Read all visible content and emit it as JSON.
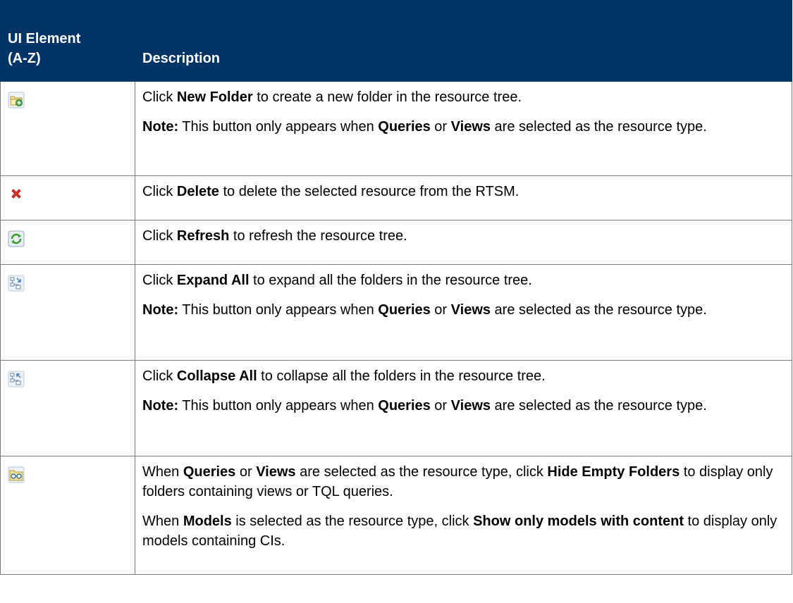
{
  "header": {
    "col1_line1": "UI Element",
    "col1_line2": "(A-Z)",
    "col2": "Description"
  },
  "rows": {
    "new_folder": {
      "icon": "new-folder-icon",
      "p1_pre": "Click ",
      "p1_bold": "New Folder",
      "p1_post": " to create a new folder in the resource tree.",
      "note_label": "Note:",
      "note_pre": " This button only appears when ",
      "note_b1": "Queries",
      "note_mid": " or ",
      "note_b2": "Views",
      "note_post": " are selected as the resource type."
    },
    "delete": {
      "icon": "delete-icon",
      "p1_pre": "Click ",
      "p1_bold": "Delete",
      "p1_post": " to delete the selected resource from the RTSM."
    },
    "refresh": {
      "icon": "refresh-icon",
      "p1_pre": "Click ",
      "p1_bold": "Refresh",
      "p1_post": " to refresh the resource tree."
    },
    "expand_all": {
      "icon": "expand-all-icon",
      "p1_pre": "Click ",
      "p1_bold": "Expand All",
      "p1_post": " to expand all the folders in the resource tree.",
      "note_label": "Note:",
      "note_pre": " This button only appears when ",
      "note_b1": "Queries",
      "note_mid": " or ",
      "note_b2": "Views",
      "note_post": " are selected as the resource type."
    },
    "collapse_all": {
      "icon": "collapse-all-icon",
      "p1_pre": "Click ",
      "p1_bold": "Collapse All",
      "p1_post": " to collapse all the folders in the resource tree.",
      "note_label": "Note:",
      "note_pre": " This button only appears when ",
      "note_b1": "Queries",
      "note_mid": " or ",
      "note_b2": "Views",
      "note_post": " are selected as the resource type."
    },
    "hide_empty": {
      "icon": "hide-empty-folders-icon",
      "p1_pre": "When ",
      "p1_b1": "Queries",
      "p1_mid1": " or ",
      "p1_b2": "Views",
      "p1_mid2": " are selected as the resource type, click ",
      "p1_b3": "Hide Empty Folders",
      "p1_post": " to display only folders containing views or TQL queries.",
      "p2_pre": "When ",
      "p2_b1": "Models",
      "p2_mid": " is selected as the resource type, click ",
      "p2_b2": "Show only models with content",
      "p2_post": " to display only models containing CIs."
    }
  },
  "colors": {
    "header_bg": "#003366",
    "header_text": "#ffffff",
    "border": "#7a7a7a"
  }
}
